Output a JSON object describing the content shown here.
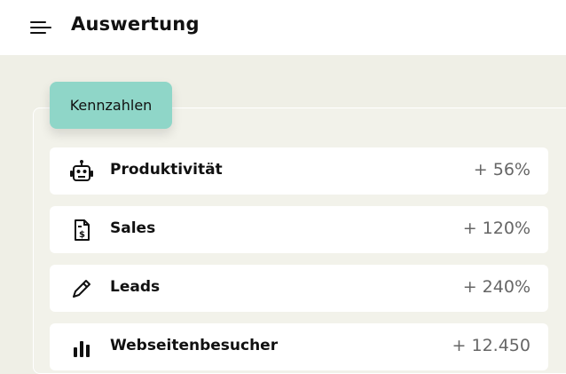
{
  "header": {
    "title": "Auswertung",
    "menu_icon": "hamburger-menu-icon"
  },
  "tab": {
    "label": "Kennzahlen",
    "color": "#8fd6c8"
  },
  "metrics": [
    {
      "icon": "robot-icon",
      "label": "Produktivität",
      "value": "+ 56%"
    },
    {
      "icon": "invoice-dollar-icon",
      "label": "Sales",
      "value": "+ 120%"
    },
    {
      "icon": "pencil-icon",
      "label": "Leads",
      "value": "+ 240%"
    },
    {
      "icon": "bar-chart-icon",
      "label": "Webseitenbesucher",
      "value": "+ 12.450"
    }
  ],
  "colors": {
    "background": "#efefe6",
    "header": "#ffffff",
    "row": "#ffffff",
    "accent": "#8fd6c8"
  }
}
